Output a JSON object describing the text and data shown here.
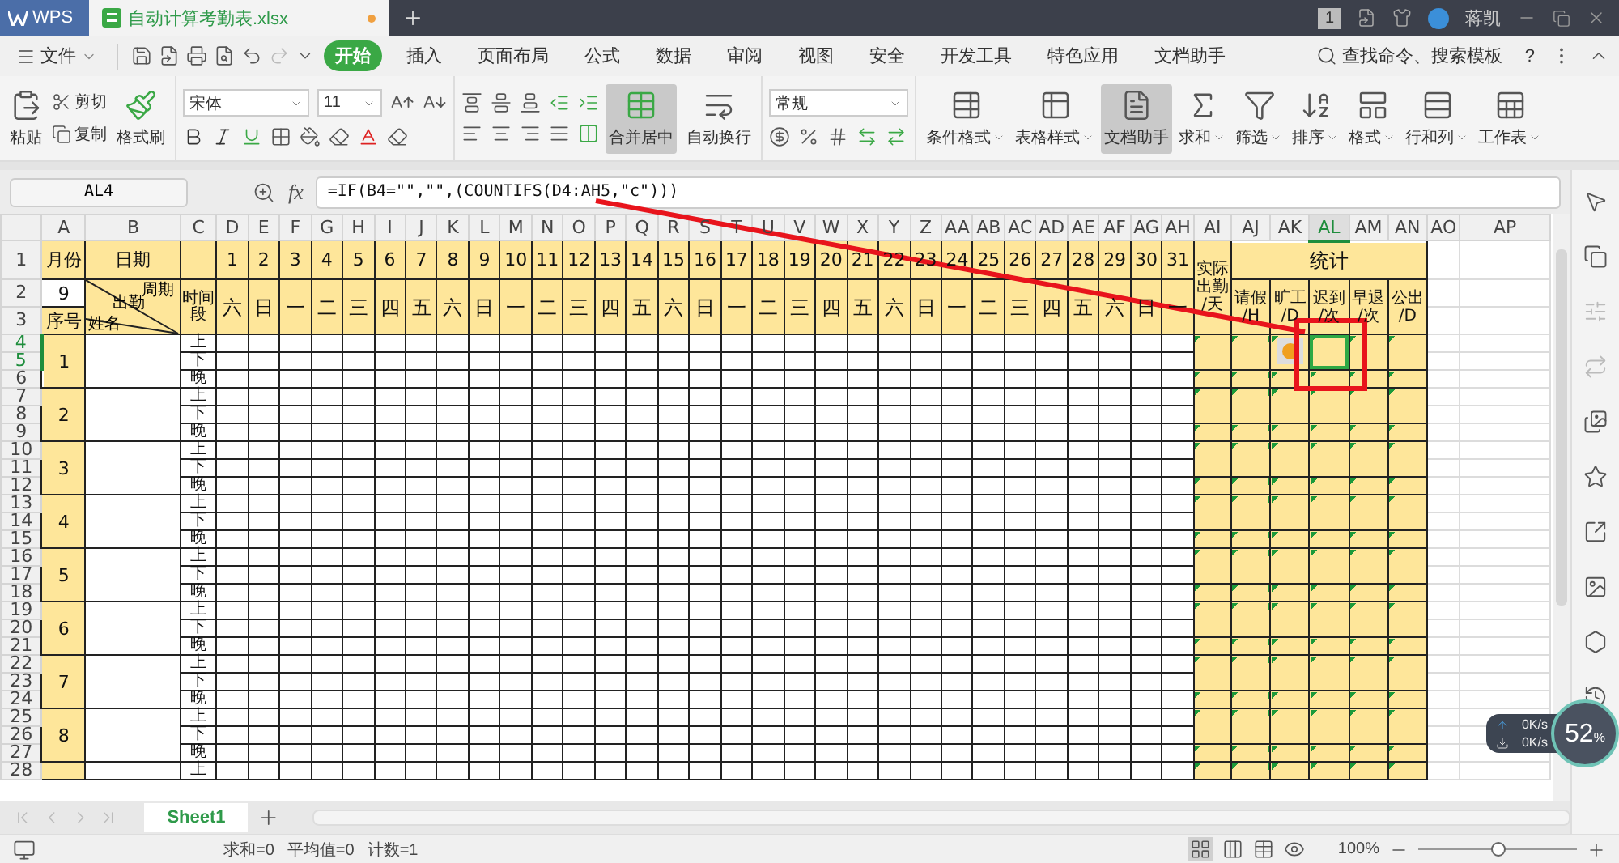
{
  "title_bar": {
    "app": "WPS",
    "file": {
      "title": "自动计算考勤表.xlsx",
      "modified": true
    },
    "page_count": "1",
    "user": "蒋凯"
  },
  "menu": {
    "file": "文件",
    "tabs": [
      {
        "label": "开始",
        "selected": true
      },
      {
        "label": "插入",
        "selected": false
      },
      {
        "label": "页面布局",
        "selected": false
      },
      {
        "label": "公式",
        "selected": false
      },
      {
        "label": "数据",
        "selected": false
      },
      {
        "label": "审阅",
        "selected": false
      },
      {
        "label": "视图",
        "selected": false
      },
      {
        "label": "安全",
        "selected": false
      },
      {
        "label": "开发工具",
        "selected": false
      },
      {
        "label": "特色应用",
        "selected": false
      },
      {
        "label": "文档助手",
        "selected": false
      }
    ],
    "search": "查找命令、搜索模板",
    "help": "?"
  },
  "ribbon": {
    "paste": "粘贴",
    "cut": "剪切",
    "copy": "复制",
    "painter": "格式刷",
    "font": "宋体",
    "size": "11",
    "merge": "合并居中",
    "wrap": "自动换行",
    "number_format": "常规",
    "tools": [
      {
        "label": "条件格式",
        "dropdown": true,
        "selected": false
      },
      {
        "label": "表格样式",
        "dropdown": true,
        "selected": false
      },
      {
        "label": "文档助手",
        "dropdown": false,
        "selected": true
      },
      {
        "label": "求和",
        "dropdown": true,
        "selected": false
      },
      {
        "label": "筛选",
        "dropdown": true,
        "selected": false
      },
      {
        "label": "排序",
        "dropdown": true,
        "selected": false
      },
      {
        "label": "格式",
        "dropdown": true,
        "selected": false
      },
      {
        "label": "行和列",
        "dropdown": true,
        "selected": false
      },
      {
        "label": "工作表",
        "dropdown": true,
        "selected": false
      }
    ]
  },
  "formula_bar": {
    "cell": "AL4",
    "fx": "fx",
    "formula": "=IF(B4=\"\",\"\",(COUNTIFS(D4:AH5,\"c\")))"
  },
  "sheet": {
    "columns": [
      {
        "label": "A",
        "selected": false
      },
      {
        "label": "B",
        "selected": false
      },
      {
        "label": "C",
        "selected": false
      },
      {
        "label": "D",
        "selected": false
      },
      {
        "label": "E",
        "selected": false
      },
      {
        "label": "F",
        "selected": false
      },
      {
        "label": "G",
        "selected": false
      },
      {
        "label": "H",
        "selected": false
      },
      {
        "label": "I",
        "selected": false
      },
      {
        "label": "J",
        "selected": false
      },
      {
        "label": "K",
        "selected": false
      },
      {
        "label": "L",
        "selected": false
      },
      {
        "label": "M",
        "selected": false
      },
      {
        "label": "N",
        "selected": false
      },
      {
        "label": "O",
        "selected": false
      },
      {
        "label": "P",
        "selected": false
      },
      {
        "label": "Q",
        "selected": false
      },
      {
        "label": "R",
        "selected": false
      },
      {
        "label": "S",
        "selected": false
      },
      {
        "label": "T",
        "selected": false
      },
      {
        "label": "U",
        "selected": false
      },
      {
        "label": "V",
        "selected": false
      },
      {
        "label": "W",
        "selected": false
      },
      {
        "label": "X",
        "selected": false
      },
      {
        "label": "Y",
        "selected": false
      },
      {
        "label": "Z",
        "selected": false
      },
      {
        "label": "AA",
        "selected": false
      },
      {
        "label": "AB",
        "selected": false
      },
      {
        "label": "AC",
        "selected": false
      },
      {
        "label": "AD",
        "selected": false
      },
      {
        "label": "AE",
        "selected": false
      },
      {
        "label": "AF",
        "selected": false
      },
      {
        "label": "AG",
        "selected": false
      },
      {
        "label": "AH",
        "selected": false
      },
      {
        "label": "AI",
        "selected": false
      },
      {
        "label": "AJ",
        "selected": false
      },
      {
        "label": "AK",
        "selected": false
      },
      {
        "label": "AL",
        "selected": true
      },
      {
        "label": "AM",
        "selected": false
      },
      {
        "label": "AN",
        "selected": false
      },
      {
        "label": "AO",
        "selected": false
      },
      {
        "label": "AP",
        "selected": false
      }
    ],
    "row_numbers": [
      {
        "label": "1",
        "selected": false
      },
      {
        "label": "2",
        "selected": false
      },
      {
        "label": "3",
        "selected": false
      },
      {
        "label": "4",
        "selected": true
      },
      {
        "label": "5",
        "selected": true
      },
      {
        "label": "6",
        "selected": false
      },
      {
        "label": "7",
        "selected": false
      },
      {
        "label": "8",
        "selected": false
      },
      {
        "label": "9",
        "selected": false
      },
      {
        "label": "10",
        "selected": false
      },
      {
        "label": "11",
        "selected": false
      },
      {
        "label": "12",
        "selected": false
      },
      {
        "label": "13",
        "selected": false
      },
      {
        "label": "14",
        "selected": false
      },
      {
        "label": "15",
        "selected": false
      },
      {
        "label": "16",
        "selected": false
      },
      {
        "label": "17",
        "selected": false
      },
      {
        "label": "18",
        "selected": false
      },
      {
        "label": "19",
        "selected": false
      },
      {
        "label": "20",
        "selected": false
      },
      {
        "label": "21",
        "selected": false
      },
      {
        "label": "22",
        "selected": false
      },
      {
        "label": "23",
        "selected": false
      },
      {
        "label": "24",
        "selected": false
      },
      {
        "label": "25",
        "selected": false
      },
      {
        "label": "26",
        "selected": false
      },
      {
        "label": "27",
        "selected": false
      },
      {
        "label": "28",
        "selected": false
      }
    ],
    "month_label": "月份",
    "date_label": "日期",
    "month_value": "9",
    "seq_label": "序号",
    "diag_top": "周期",
    "diag_mid": "出勤",
    "diag_bottom": "姓名",
    "period_label": "时间段",
    "actual_label": "实际出勤",
    "actual_unit": "/天",
    "stats_label": "统计",
    "days": [
      "1",
      "2",
      "3",
      "4",
      "5",
      "6",
      "7",
      "8",
      "9",
      "10",
      "11",
      "12",
      "13",
      "14",
      "15",
      "16",
      "17",
      "18",
      "19",
      "20",
      "21",
      "22",
      "23",
      "24",
      "25",
      "26",
      "27",
      "28",
      "29",
      "30",
      "31"
    ],
    "weekdays": [
      "六",
      "日",
      "一",
      "二",
      "三",
      "四",
      "五",
      "六",
      "日",
      "一",
      "二",
      "三",
      "四",
      "五",
      "六",
      "日",
      "一",
      "二",
      "三",
      "四",
      "五",
      "六",
      "日",
      "一",
      "二",
      "三",
      "四",
      "五",
      "六",
      "日",
      "一"
    ],
    "stat_columns": [
      {
        "name": "请假",
        "unit": "/H"
      },
      {
        "name": "旷工",
        "unit": "/D"
      },
      {
        "name": "迟到",
        "unit": "/次"
      },
      {
        "name": "早退",
        "unit": "/次"
      },
      {
        "name": "公出",
        "unit": "/D"
      }
    ],
    "persons": [
      {
        "no": "1",
        "periods": [
          "上",
          "下",
          "晚"
        ]
      },
      {
        "no": "2",
        "periods": [
          "上",
          "下",
          "晚"
        ]
      },
      {
        "no": "3",
        "periods": [
          "上",
          "下",
          "晚"
        ]
      },
      {
        "no": "4",
        "periods": [
          "上",
          "下",
          "晚"
        ]
      },
      {
        "no": "5",
        "periods": [
          "上",
          "下",
          "晚"
        ]
      },
      {
        "no": "6",
        "periods": [
          "上",
          "下",
          "晚"
        ]
      },
      {
        "no": "7",
        "periods": [
          "上",
          "下",
          "晚"
        ]
      },
      {
        "no": "8",
        "periods": [
          "上",
          "下",
          "晚"
        ]
      }
    ],
    "partial_row": {
      "period": "上"
    }
  },
  "sheet_tabs": [
    {
      "label": "Sheet1",
      "selected": true
    }
  ],
  "status_bar": {
    "sum": "求和=0",
    "average": "平均值=0",
    "count": "计数=1",
    "zoom": {
      "label": "100%",
      "level": 0.5
    }
  },
  "net_widget": {
    "upload": "0K/s",
    "download": "0K/s",
    "percent": "52",
    "unit": "%"
  }
}
